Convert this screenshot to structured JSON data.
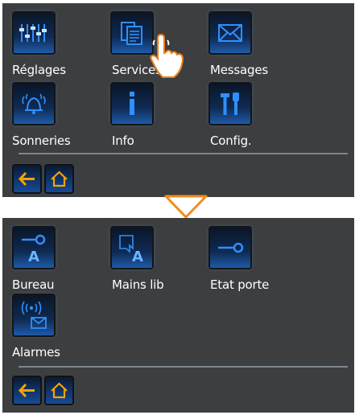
{
  "screens": [
    {
      "tiles": [
        {
          "name": "reglages",
          "label": "Réglages",
          "icon": "sliders-icon"
        },
        {
          "name": "services",
          "label": "Services",
          "icon": "documents-icon"
        },
        {
          "name": "messages",
          "label": "Messages",
          "icon": "envelope-icon"
        },
        {
          "name": "sonneries",
          "label": "Sonneries",
          "icon": "bell-icon"
        },
        {
          "name": "info",
          "label": "Info",
          "icon": "info-icon"
        },
        {
          "name": "config",
          "label": "Config.",
          "icon": "tools-icon"
        }
      ],
      "nav": [
        {
          "name": "back",
          "icon": "arrow-left-icon"
        },
        {
          "name": "home",
          "icon": "home-icon"
        }
      ]
    },
    {
      "tiles": [
        {
          "name": "bureau",
          "label": "Bureau",
          "icon": "key-a-icon"
        },
        {
          "name": "mains-lib",
          "label": "Mains lib",
          "icon": "hand-a-icon"
        },
        {
          "name": "etat-porte",
          "label": "Etat porte",
          "icon": "key-icon"
        },
        {
          "name": "alarmes",
          "label": "Alarmes",
          "icon": "alarm-envelope-icon"
        }
      ],
      "nav": [
        {
          "name": "back",
          "icon": "arrow-left-icon"
        },
        {
          "name": "home",
          "icon": "home-icon"
        }
      ]
    }
  ],
  "colors": {
    "panel": "#3d3e40",
    "icon_glyph": "#2f8fff",
    "nav_accent": "#f5a200",
    "transition_arrow": "#f28c1e"
  }
}
